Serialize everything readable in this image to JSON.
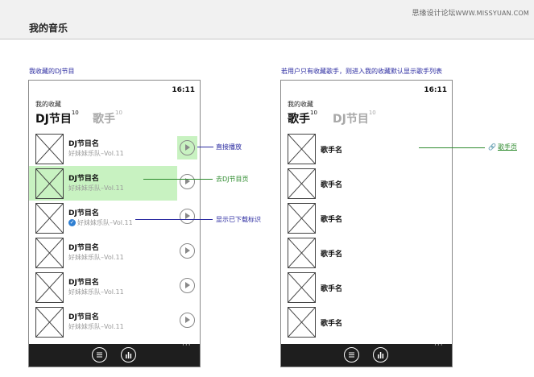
{
  "header": {
    "title": "我的音乐"
  },
  "watermark": {
    "cn": "思缘设计论坛",
    "en": "WWW.MISSYUAN.COM"
  },
  "left": {
    "caption": "我收藏的DJ节目",
    "time": "16:11",
    "section": "我的收藏",
    "tabs": [
      {
        "label": "DJ节目",
        "count": "10"
      },
      {
        "label": "歌手",
        "count": "10"
      }
    ],
    "items": [
      {
        "title": "DJ节目名",
        "subtitle": "好妹妹乐队–Vol.11"
      },
      {
        "title": "DJ节目名",
        "subtitle": "好妹妹乐队–Vol.11"
      },
      {
        "title": "DJ节目名",
        "subtitle": "好妹妹乐队–Vol.11"
      },
      {
        "title": "DJ节目名",
        "subtitle": "好妹妹乐队–Vol.11"
      },
      {
        "title": "DJ节目名",
        "subtitle": "好妹妹乐队–Vol.11"
      },
      {
        "title": "DJ节目名",
        "subtitle": "好妹妹乐队–Vol.11"
      }
    ],
    "annotations": {
      "play": "直接播放",
      "page": "去DJ节目页",
      "downloaded": "显示已下载标识"
    },
    "more": "···"
  },
  "right": {
    "caption": "若用户只有收藏歌手，则进入我的收藏默认显示歌手列表",
    "time": "16:11",
    "section": "我的收藏",
    "tabs": [
      {
        "label": "歌手",
        "count": "10"
      },
      {
        "label": "DJ节目",
        "count": "10"
      }
    ],
    "items": [
      {
        "name": "歌手名"
      },
      {
        "name": "歌手名"
      },
      {
        "name": "歌手名"
      },
      {
        "name": "歌手名"
      },
      {
        "name": "歌手名"
      },
      {
        "name": "歌手名"
      }
    ],
    "annotations": {
      "singer_page": "歌手页"
    },
    "more": "···"
  },
  "colors": {
    "highlight": "#c8f2c1",
    "annotation_blue": "#2a2aa0",
    "annotation_green": "#2e8b2e",
    "appbar": "#1e1e1e"
  }
}
